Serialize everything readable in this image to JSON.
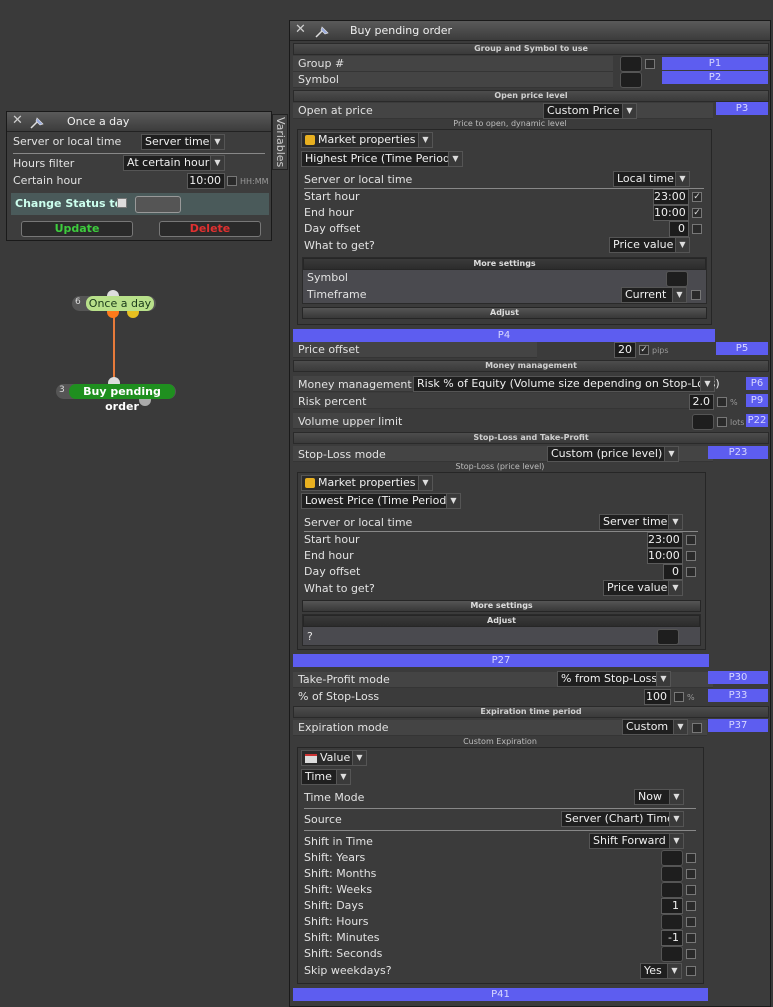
{
  "once_window": {
    "title": "Once a day",
    "server_or_local_label": "Server or local time",
    "server_or_local_value": "Server time",
    "hours_filter_label": "Hours filter",
    "hours_filter_value": "At certain hour",
    "certain_hour_label": "Certain hour",
    "certain_hour_value": "10:00",
    "certain_hour_unit": "HH:MM",
    "change_status_label": "Change Status to",
    "update_label": "Update",
    "delete_label": "Delete",
    "variables_tab": "Variables"
  },
  "graph": {
    "node1_index": "6",
    "node1_label": "Once a day",
    "node2_index": "3",
    "node2_label": "Buy pending order"
  },
  "buy_window": {
    "title": "Buy pending order",
    "sec_group": "Group and Symbol to use",
    "group_label": "Group #",
    "symbol_label": "Symbol",
    "p1": "P1",
    "p2": "P2",
    "sec_open": "Open price level",
    "open_label": "Open at price",
    "open_value": "Custom Price",
    "p3": "P3",
    "sub_open": "Price to open, dynamic level",
    "mp1": "Market properties",
    "highest": "Highest Price (Time Period)",
    "sl_time_label": "Server or local time",
    "sl_time_value": "Local time",
    "start_label": "Start hour",
    "start_value": "23:00",
    "end_label": "End hour",
    "end_value": "10:00",
    "dayoff_label": "Day offset",
    "dayoff_value": "0",
    "what_label": "What to get?",
    "what_value": "Price value",
    "more_settings": "More settings",
    "ms_symbol": "Symbol",
    "ms_timeframe": "Timeframe",
    "ms_timeframe_value": "Current",
    "adjust": "Adjust",
    "p4": "P4",
    "offset_label": "Price offset",
    "offset_value": "20",
    "offset_unit": "pips",
    "p5": "P5",
    "sec_money": "Money management",
    "mm_label": "Money management",
    "mm_value": "Risk % of Equity (Volume size depending on Stop-Loss)",
    "p6": "P6",
    "risk_label": "Risk percent",
    "risk_value": "2.0",
    "risk_unit": "%",
    "p9": "P9",
    "vol_label": "Volume upper limit",
    "vol_unit": "lots",
    "p22": "P22",
    "sec_sltp": "Stop-Loss and Take-Profit",
    "sl_mode_label": "Stop-Loss mode",
    "sl_mode_value": "Custom (price level)",
    "p23": "P23",
    "sub_sl": "Stop-Loss (price level)",
    "mp2": "Market properties",
    "lowest": "Lowest Price (Time Period)",
    "sl2_time_label": "Server or local time",
    "sl2_time_value": "Server time",
    "start2_label": "Start hour",
    "start2_value": "23:00",
    "end2_label": "End hour",
    "end2_value": "10:00",
    "dayoff2_label": "Day offset",
    "dayoff2_value": "0",
    "what2_label": "What to get?",
    "what2_value": "Price value",
    "more_settings2": "More settings",
    "adjust2": "Adjust",
    "q_label": "?",
    "p27": "P27",
    "tp_mode_label": "Take-Profit mode",
    "tp_mode_value": "% from Stop-Loss",
    "p30": "P30",
    "pct_sl_label": "% of Stop-Loss",
    "pct_sl_value": "100",
    "pct_sl_unit": "%",
    "p33": "P33",
    "sec_exp": "Expiration time period",
    "exp_label": "Expiration mode",
    "exp_value": "Custom",
    "p37": "P37",
    "sub_exp": "Custom Expiration",
    "value_label": "Value",
    "time_label": "Time",
    "time_mode_label": "Time Mode",
    "time_mode_value": "Now",
    "source_label": "Source",
    "source_value": "Server (Chart) Time",
    "shift_label": "Shift in Time",
    "shift_value": "Shift Forward",
    "years": "Shift: Years",
    "months": "Shift: Months",
    "weeks": "Shift: Weeks",
    "days": "Shift: Days",
    "days_value": "1",
    "hours": "Shift: Hours",
    "minutes": "Shift: Minutes",
    "minutes_value": "-1",
    "seconds": "Shift: Seconds",
    "skip_label": "Skip weekdays?",
    "skip_value": "Yes",
    "p41": "P41"
  },
  "colors": {
    "accent": "#5d5df0",
    "update": "#3dcc3d",
    "delete": "#e03030",
    "node_green": "#1f8f1f",
    "node_light": "#b8e08a",
    "link": "#e67a3a"
  }
}
